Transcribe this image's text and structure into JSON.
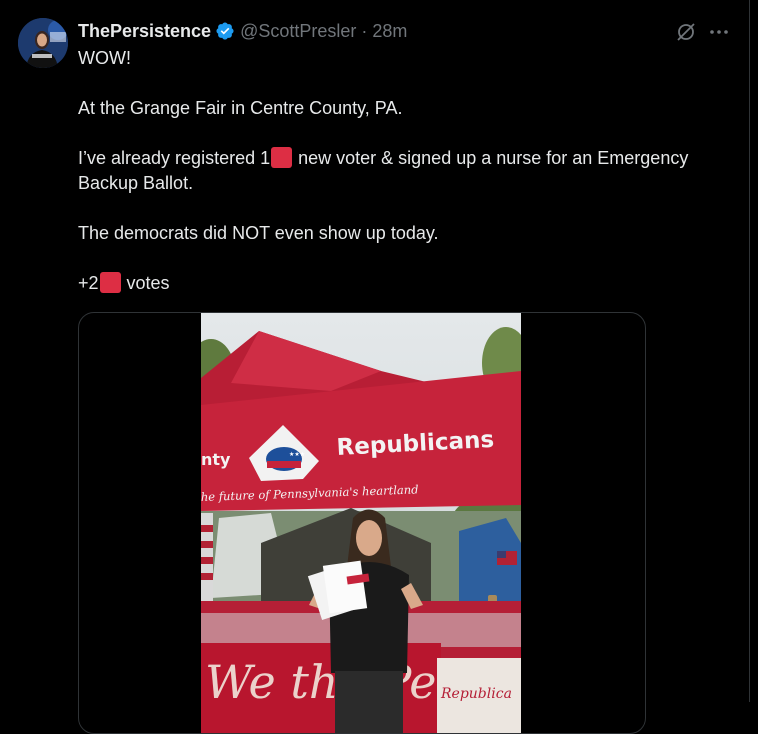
{
  "tweet": {
    "display_name": "ThePersistence",
    "handle": "@ScottPresler",
    "separator": "·",
    "time": "28m",
    "lines": {
      "l1": "WOW!",
      "l2": "At the Grange Fair in Centre County, PA.",
      "l3a": "I’ve already registered 1",
      "l3b": " new voter & signed up a nurse for an Emergency Backup Ballot.",
      "l4": "The democrats did NOT even show up today.",
      "l5a": "+2",
      "l5b": " votes"
    },
    "emoji": "red-square-emoji"
  },
  "media": {
    "banner_party": "Republicans",
    "banner_left": "nty",
    "banner_tagline": "he future of Pennsylvania's heartland",
    "table_script": "We the People",
    "sign_text": "Republica"
  },
  "colors": {
    "background": "#000000",
    "text": "#e7e9ea",
    "muted": "#71767b",
    "verified": "#1d9bf0",
    "emoji_red": "#dd2e44",
    "tent_red": "#c8243a"
  },
  "icons": [
    "verified-badge-icon",
    "grok-icon",
    "more-options-icon"
  ]
}
